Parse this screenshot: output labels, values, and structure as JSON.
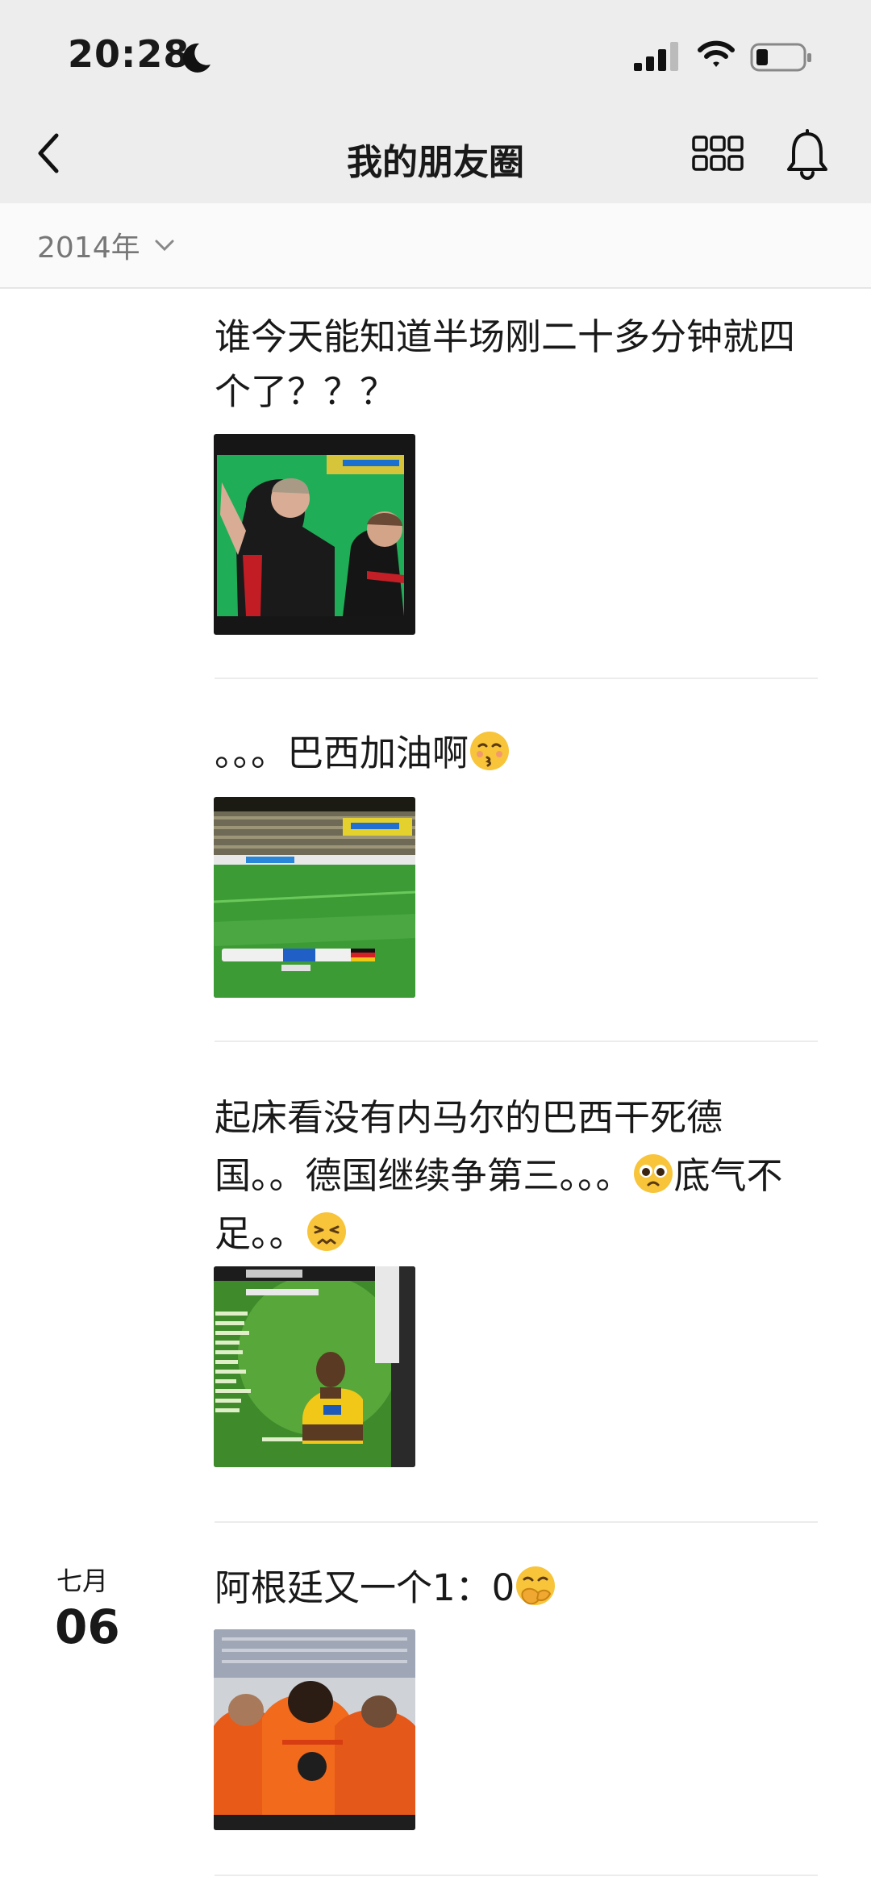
{
  "status_bar": {
    "time": "20:28"
  },
  "nav": {
    "title": "我的朋友圈"
  },
  "filter": {
    "year": "2014年"
  },
  "posts": [
    {
      "text": "谁今天能知道半场刚二十多分钟就四个了？？？"
    },
    {
      "text": "。。。巴西加油啊"
    },
    {
      "text_line1": "起床看没有内马尔的巴西干死德",
      "text_line2_a": "国。。德国继续争第三。。。",
      "text_line2_b": "底气不",
      "text_line3": "足。。"
    },
    {
      "text": "阿根廷又一个1：0",
      "date_month": "七月",
      "date_day": "06"
    }
  ]
}
